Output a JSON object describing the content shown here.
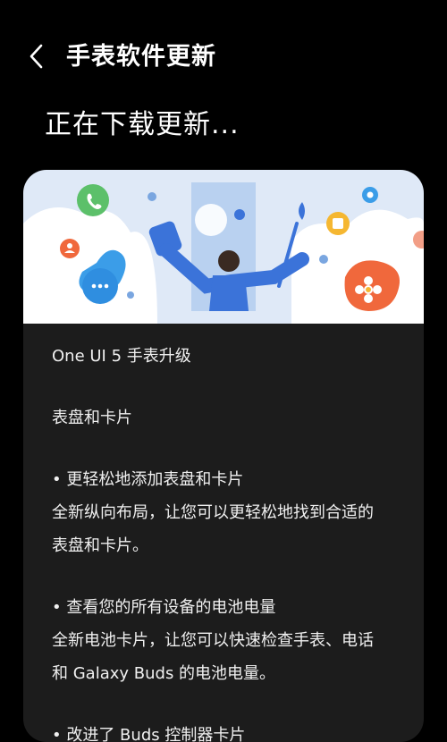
{
  "header": {
    "title": "手表软件更新"
  },
  "status": {
    "heading": "正在下载更新..."
  },
  "icons": {
    "back": "chevron-left-icon",
    "phone": "phone-icon",
    "chat": "chat-bubble-icon",
    "flower": "flower-icon",
    "gear": "gear-icon",
    "square": "square-icon",
    "person": "person-icon"
  },
  "colors": {
    "background": "#000000",
    "card": "#1c1c1c",
    "banner_sky": "#dfe9f7",
    "accent_blue": "#3b73d9",
    "accent_orange": "#f0683c",
    "accent_green": "#5cc06a",
    "accent_yellow": "#f5b731"
  },
  "notes": {
    "title": "One UI 5 手表升级",
    "section": "表盘和卡片",
    "bullet1": "• 更轻松地添加表盘和卡片",
    "bullet1_line1": "全新纵向布局，让您可以更轻松地找到合适的",
    "bullet1_line2": "表盘和卡片。",
    "bullet2": "• 查看您的所有设备的电池电量",
    "bullet2_line1": "全新电池卡片，让您可以快速检查手表、电话",
    "bullet2_line2": "和 Galaxy Buds 的电池电量。",
    "bullet3": "• 改进了 Buds 控制器卡片"
  }
}
